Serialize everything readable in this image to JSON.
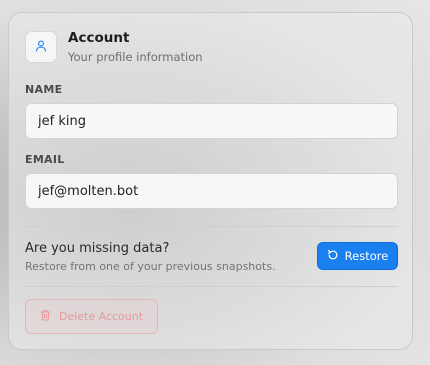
{
  "header": {
    "icon": "user-icon",
    "title": "Account",
    "subtitle": "Your profile information"
  },
  "fields": {
    "name": {
      "label": "NAME",
      "value": "jef king"
    },
    "email": {
      "label": "EMAIL",
      "value": "jef@molten.bot"
    }
  },
  "restore": {
    "title": "Are you missing data?",
    "subtitle": "Restore from one of your previous snapshots.",
    "button_label": "Restore",
    "button_icon": "refresh-icon"
  },
  "delete": {
    "button_label": "Delete Account",
    "button_icon": "trash-icon"
  },
  "colors": {
    "accent": "#1a7fef",
    "danger": "#e79a9a"
  }
}
